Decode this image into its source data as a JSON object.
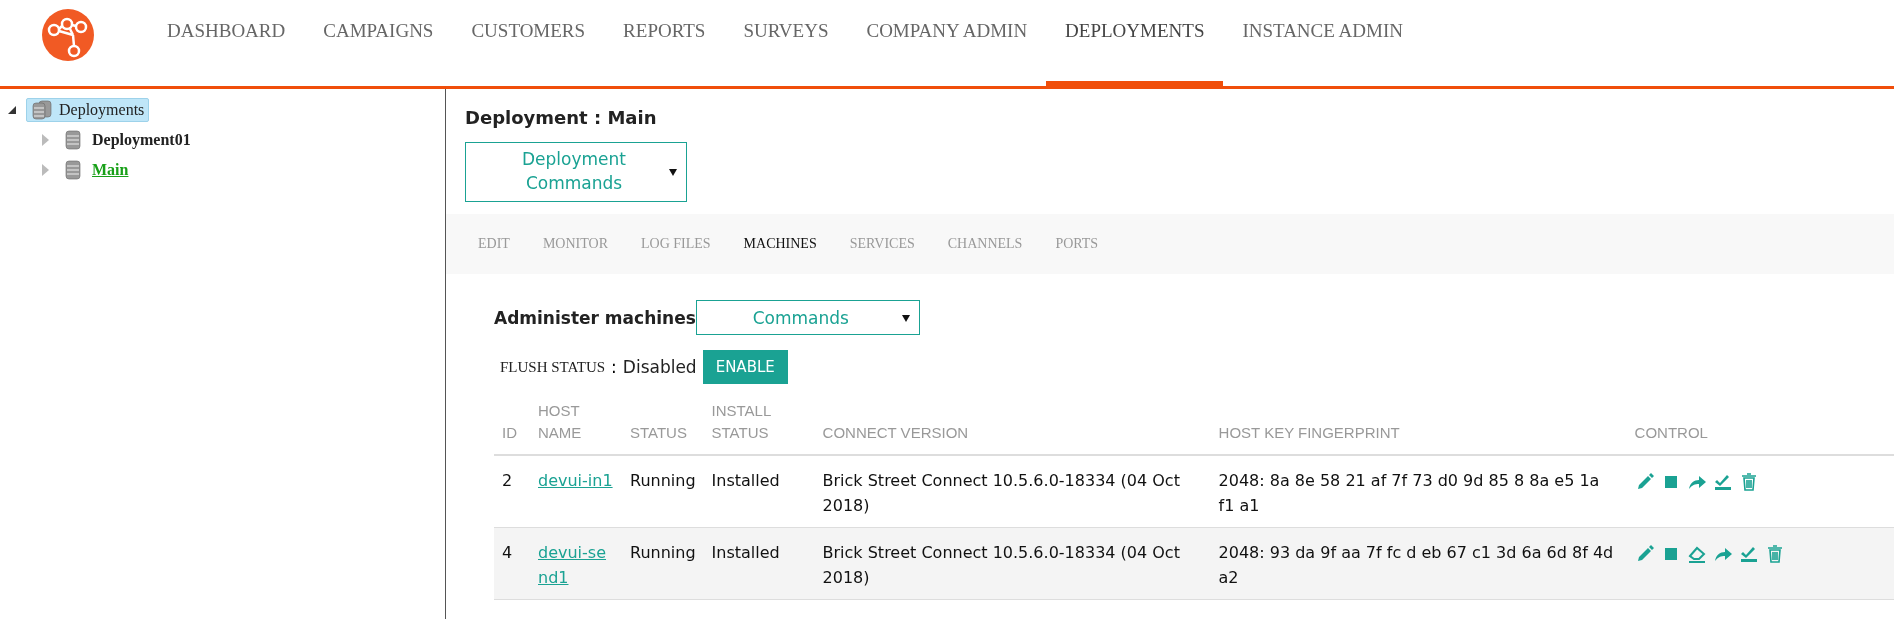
{
  "nav": {
    "items": [
      {
        "label": "DASHBOARD",
        "selected": false
      },
      {
        "label": "CAMPAIGNS",
        "selected": false
      },
      {
        "label": "CUSTOMERS",
        "selected": false
      },
      {
        "label": "REPORTS",
        "selected": false
      },
      {
        "label": "SURVEYS",
        "selected": false
      },
      {
        "label": "COMPANY ADMIN",
        "selected": false
      },
      {
        "label": "DEPLOYMENTS",
        "selected": true
      },
      {
        "label": "INSTANCE ADMIN",
        "selected": false
      }
    ]
  },
  "tree": [
    {
      "label": "Deployments",
      "kind": "group",
      "selected": true,
      "expanded": true,
      "current": false,
      "children": [
        {
          "label": "Deployment01",
          "kind": "db",
          "selected": false,
          "expanded": false,
          "current": false
        },
        {
          "label": "Main",
          "kind": "db",
          "selected": false,
          "expanded": false,
          "current": true
        }
      ]
    }
  ],
  "main": {
    "title": "Deployment : Main",
    "commands_dropdown": "Deployment Commands",
    "tabs": [
      {
        "label": "EDIT",
        "selected": false
      },
      {
        "label": "MONITOR",
        "selected": false
      },
      {
        "label": "LOG FILES",
        "selected": false
      },
      {
        "label": "MACHINES",
        "selected": true
      },
      {
        "label": "SERVICES",
        "selected": false
      },
      {
        "label": "CHANNELS",
        "selected": false
      },
      {
        "label": "PORTS",
        "selected": false
      }
    ],
    "section_title": "Administer machines",
    "section_dropdown": "Commands",
    "flush": {
      "label": "FLUSH STATUS",
      "separator": ":",
      "value": "Disabled",
      "button": "ENABLE"
    },
    "table": {
      "columns": [
        "ID",
        "HOST NAME",
        "STATUS",
        "INSTALL STATUS",
        "CONNECT VERSION",
        "HOST KEY FINGERPRINT",
        "CONTROL"
      ],
      "rows": [
        {
          "id": "2",
          "host": "devui-in1",
          "status": "Running",
          "install": "Installed",
          "version": "Brick Street Connect 10.5.6.0-18334 (04 Oct 2018)",
          "fingerprint": "2048: 8a 8e 58 21 af 7f 73 d0 9d 85 8 8a e5 1a f1 a1",
          "controls": [
            {
              "kind": "edit"
            },
            {
              "kind": "stop"
            },
            {
              "kind": "forward"
            },
            {
              "kind": "check"
            },
            {
              "kind": "trash"
            }
          ]
        },
        {
          "id": "4",
          "host": "devui-send1",
          "status": "Running",
          "install": "Installed",
          "version": "Brick Street Connect 10.5.6.0-18334 (04 Oct 2018)",
          "fingerprint": "2048: 93 da 9f aa 7f fc d eb 67 c1 3d 6a 6d 8f 4d a2",
          "controls": [
            {
              "kind": "edit"
            },
            {
              "kind": "stop"
            },
            {
              "kind": "eraser"
            },
            {
              "kind": "forward"
            },
            {
              "kind": "check"
            },
            {
              "kind": "trash"
            }
          ]
        }
      ]
    }
  }
}
